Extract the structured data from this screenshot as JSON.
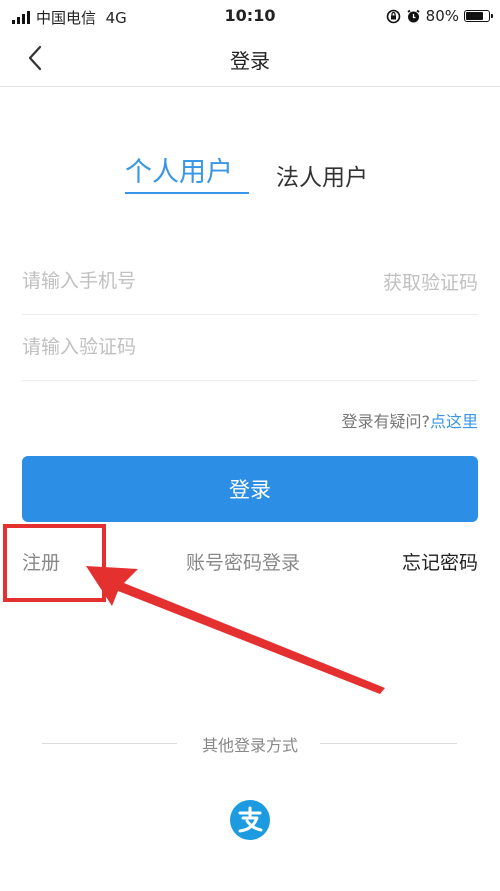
{
  "status_bar": {
    "carrier": "中国电信",
    "network": "4G",
    "time": "10:10",
    "battery": "80%",
    "battery_level": 0.8
  },
  "nav": {
    "title": "登录",
    "back_icon": "chevron-left-icon"
  },
  "tabs": [
    {
      "label": "个人用户",
      "active": true
    },
    {
      "label": "法人用户",
      "active": false
    }
  ],
  "form": {
    "phone_placeholder": "请输入手机号",
    "get_code_label": "获取验证码",
    "code_placeholder": "请输入验证码"
  },
  "help": {
    "text": "登录有疑问?",
    "link": "点这里"
  },
  "login_button": "登录",
  "links": {
    "register": "注册",
    "password_login": "账号密码登录",
    "forgot_password": "忘记密码"
  },
  "other_login": {
    "label": "其他登录方式",
    "alipay_icon": "alipay-icon"
  },
  "colors": {
    "accent": "#2d8ee5",
    "annotation": "#e53030"
  }
}
